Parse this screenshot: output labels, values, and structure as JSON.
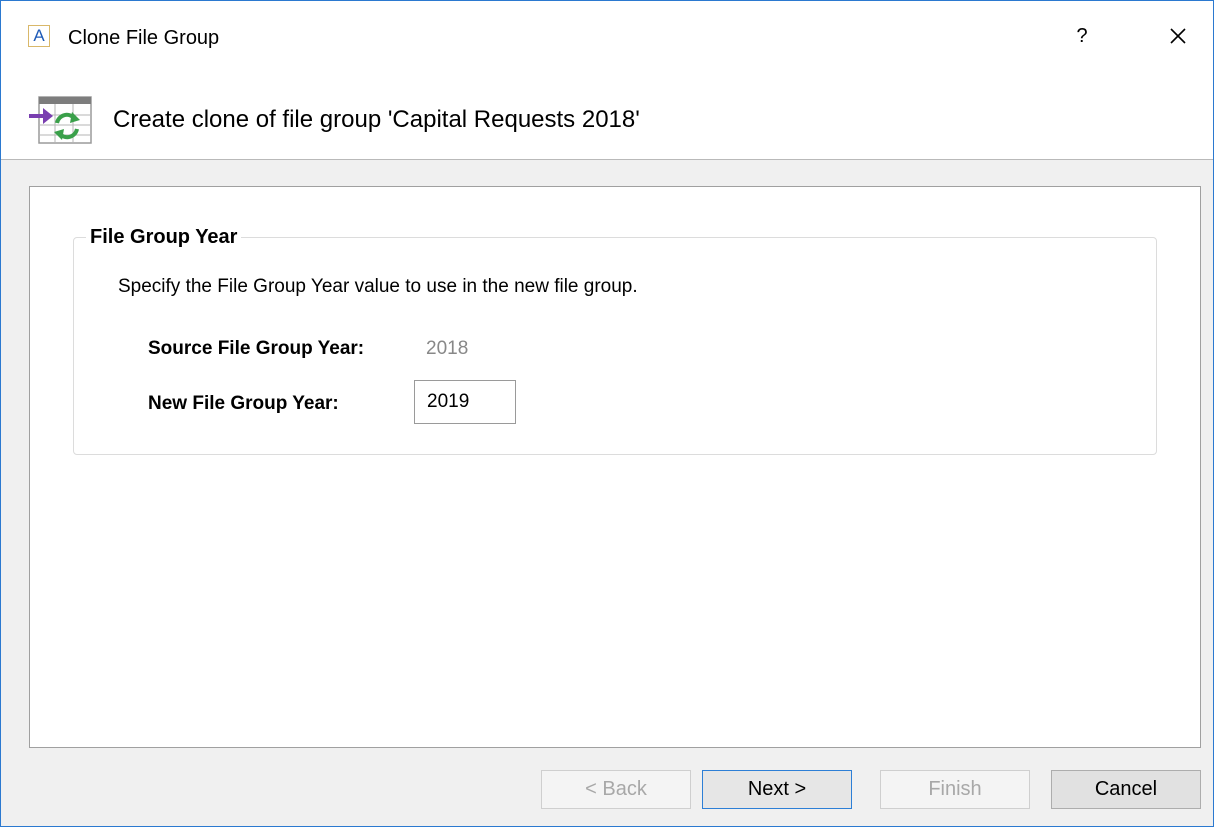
{
  "window": {
    "title": "Clone File Group",
    "app_icon_letter": "A",
    "help_label": "?",
    "close_icon": "close-icon"
  },
  "header": {
    "title": "Create clone of file group 'Capital Requests 2018'",
    "icon": "wizard-clone-icon"
  },
  "group": {
    "legend": "File Group Year",
    "description": "Specify the File Group Year value to use in the new file group.",
    "source_label": "Source File Group Year:",
    "source_value": "2018",
    "new_label": "New File Group Year:",
    "new_value": "2019"
  },
  "buttons": {
    "back": "< Back",
    "next": "Next >",
    "finish": "Finish",
    "cancel": "Cancel"
  },
  "colors": {
    "accent": "#2b79d0",
    "disabled_text": "#a8a8a8",
    "icon_purple": "#7a3fb0",
    "icon_green": "#3aa04a"
  }
}
